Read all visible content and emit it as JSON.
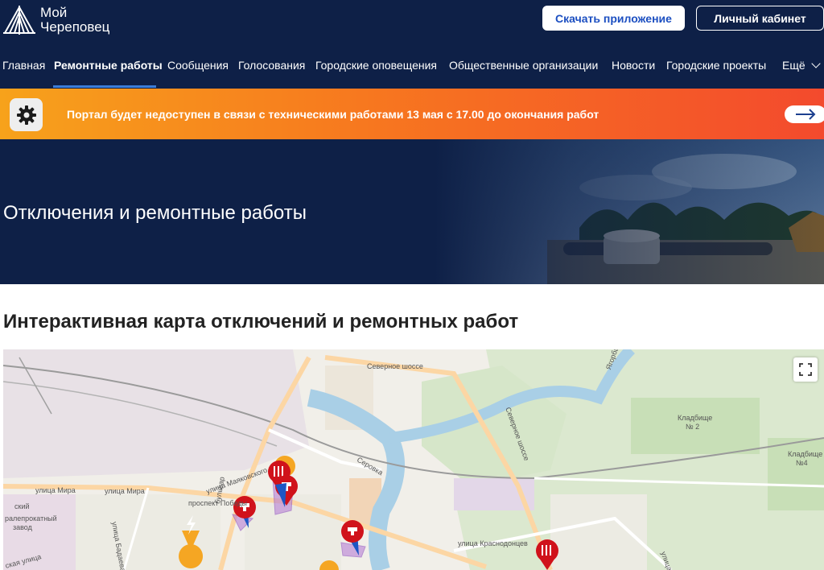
{
  "header": {
    "logo_line1": "Мой",
    "logo_line2": "Череповец",
    "download_app": "Скачать приложение",
    "personal_account": "Личный кабинет"
  },
  "nav": {
    "items": [
      {
        "label": "Главная"
      },
      {
        "label": "Ремонтные работы"
      },
      {
        "label": "Сообщения"
      },
      {
        "label": "Голосования"
      },
      {
        "label": "Городские оповещения"
      },
      {
        "label": "Общественные организации"
      },
      {
        "label": "Новости"
      },
      {
        "label": "Городские проекты"
      },
      {
        "label": "Ещё"
      }
    ],
    "active_index": 1
  },
  "alert": {
    "text": "Портал будет недоступен в связи с техническими работами 13 мая с 17.00 до окончания работ",
    "icon": "gear-icon",
    "action_icon": "arrow-right-icon"
  },
  "hero": {
    "title": "Отключения и ремонтные работы"
  },
  "section": {
    "title": "Интерактивная карта отключений и ремонтных работ"
  },
  "map": {
    "labels": {
      "severnoe_shosse_top": "Северное шоссе",
      "severnoe_shosse_side": "Северное шоссе",
      "ulitsa_mira_1": "улица Мира",
      "ulitsa_mira_2": "улица Мира",
      "ulitsa_mayakovskogo": "улица Маяковского",
      "prospekt_pobedy": "проспект Победы",
      "ulitsa_krasnodontsev": "улица Краснодонцев",
      "ulitsa_badaeva": "улица Бадаева",
      "serovka": "Серовка",
      "yagorba": "Ягорба",
      "kladbishche2_a": "Кладбище",
      "kladbishche2_b": "№ 2",
      "kladbishche4_a": "Кладбище",
      "kladbishche4_b": "№4",
      "zavod_a": "ралепрокатный",
      "zavod_b": "завод",
      "bulvar": "бульвар",
      "street_left": "ская улица",
      "street_right": "улица",
      "zavod_c": "ский"
    },
    "markers": [
      {
        "type": "electricity",
        "color": "#f5a623",
        "icon": "lightning-icon"
      },
      {
        "type": "water",
        "color": "#d0121b",
        "icon": "faucet-icon"
      },
      {
        "type": "heating",
        "color": "#d0121b",
        "icon": "heating-icon"
      },
      {
        "type": "water-blue",
        "color": "#1d56c4",
        "icon": "faucet-icon"
      }
    ],
    "fullscreen_icon": "fullscreen-icon"
  }
}
